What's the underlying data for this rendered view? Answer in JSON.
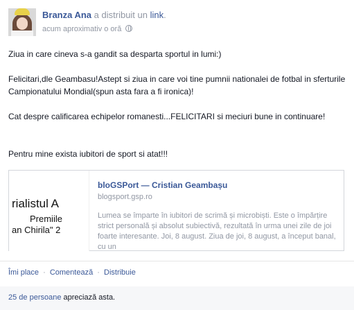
{
  "post": {
    "author": "Branza Ana",
    "action": "a distribuit un",
    "link_word": "link",
    "period": ".",
    "timestamp": "acum aproximativ o oră",
    "privacy_icon": "globe-icon",
    "messages": [
      "Ziua in care cineva s-a gandit sa desparta sportul in lumi:)",
      "Felicitari,dle Geambasu!Astept si ziua in care voi tine pumnii nationalei de fotbal in sferturile Campionatului Mondial(spun asta fara a fi ironica)!",
      "Cat despre calificarea echipelor romanesti...FELICITARI si meciuri bune in continuare!",
      "Pentru mine exista iubitori de sport si atat!!!"
    ]
  },
  "attachment": {
    "thumb_lines": [
      "rialistul A",
      "Premiile",
      "an Chirila\" 2"
    ],
    "title": "bloGSPort — Cristian Geambașu",
    "source": "blogsport.gsp.ro",
    "description": "Lumea se împarte în iubitori de scrimă și microbiști. Este o împărțire strict personală și absolut subiectivă, rezultată în urma unei zile de joi foarte interesante. Joi, 8 august. Ziua de joi, 8 august, a început banal, cu un"
  },
  "actions": {
    "like": "Îmi place",
    "comment": "Comentează",
    "share": "Distribuie",
    "separator": "·"
  },
  "likes": {
    "count_text": "25 de persoane",
    "rest_text": "apreciază asta."
  },
  "colors": {
    "link_blue": "#3b5998",
    "meta_gray": "#9197a3",
    "text": "#141823"
  }
}
